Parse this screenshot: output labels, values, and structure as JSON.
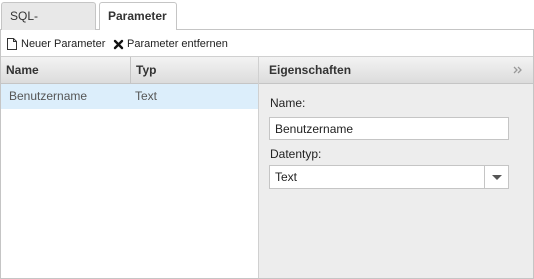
{
  "tabs": [
    {
      "label": "SQL-Ausdruck",
      "active": false
    },
    {
      "label": "Parameter",
      "active": true
    }
  ],
  "toolbar": {
    "new_label": "Neuer Parameter",
    "remove_label": "Parameter entfernen"
  },
  "grid": {
    "columns": [
      "Name",
      "Typ"
    ],
    "rows": [
      {
        "name": "Benutzername",
        "typ": "Text",
        "selected": true
      }
    ]
  },
  "properties": {
    "title": "Eigenschaften",
    "name_label": "Name:",
    "name_value": "Benutzername",
    "type_label": "Datentyp:",
    "type_value": "Text"
  },
  "colors": {
    "selected_row": "#dceefb",
    "panel_bg": "#ededed",
    "border": "#c5c5c5"
  }
}
